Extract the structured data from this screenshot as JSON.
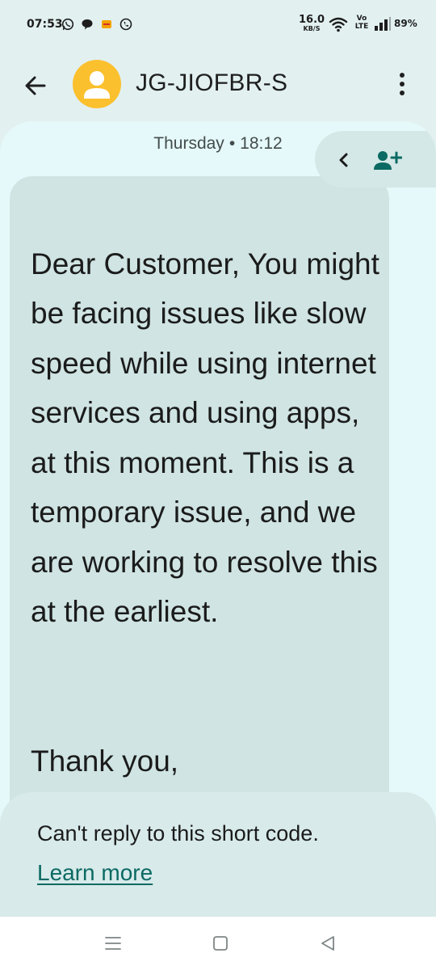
{
  "status_bar": {
    "time": "07:53",
    "left_icons": [
      "whatsapp-icon",
      "chat-bubble-icon",
      "app-notification-icon",
      "phone-call-icon"
    ],
    "network_speed_value": "16.0",
    "network_speed_unit": "KB/S",
    "volte_top": "Vo",
    "volte_bottom": "LTE",
    "battery": "89%"
  },
  "app_bar": {
    "contact_name": "JG-JIOFBR-S",
    "avatar_color": "#fbc02d"
  },
  "conversation": {
    "timestamp_day": "Thursday",
    "timestamp_separator": "•",
    "timestamp_time": "18:12",
    "message_body": "Dear Customer, You might be facing issues like slow speed while using internet services and using apps, at this moment. This is a temporary issue, and we are working to resolve this at the earliest.",
    "message_signoff": "Thank you,"
  },
  "reply_notice": {
    "text": "Can't reply to this short code.",
    "link": "Learn more",
    "link_color": "#0b6a63"
  },
  "colors": {
    "background": "#e2f0f0",
    "panel": "#e5f9fa",
    "bubble": "#cfe4e3",
    "accent": "#0b6a63"
  }
}
